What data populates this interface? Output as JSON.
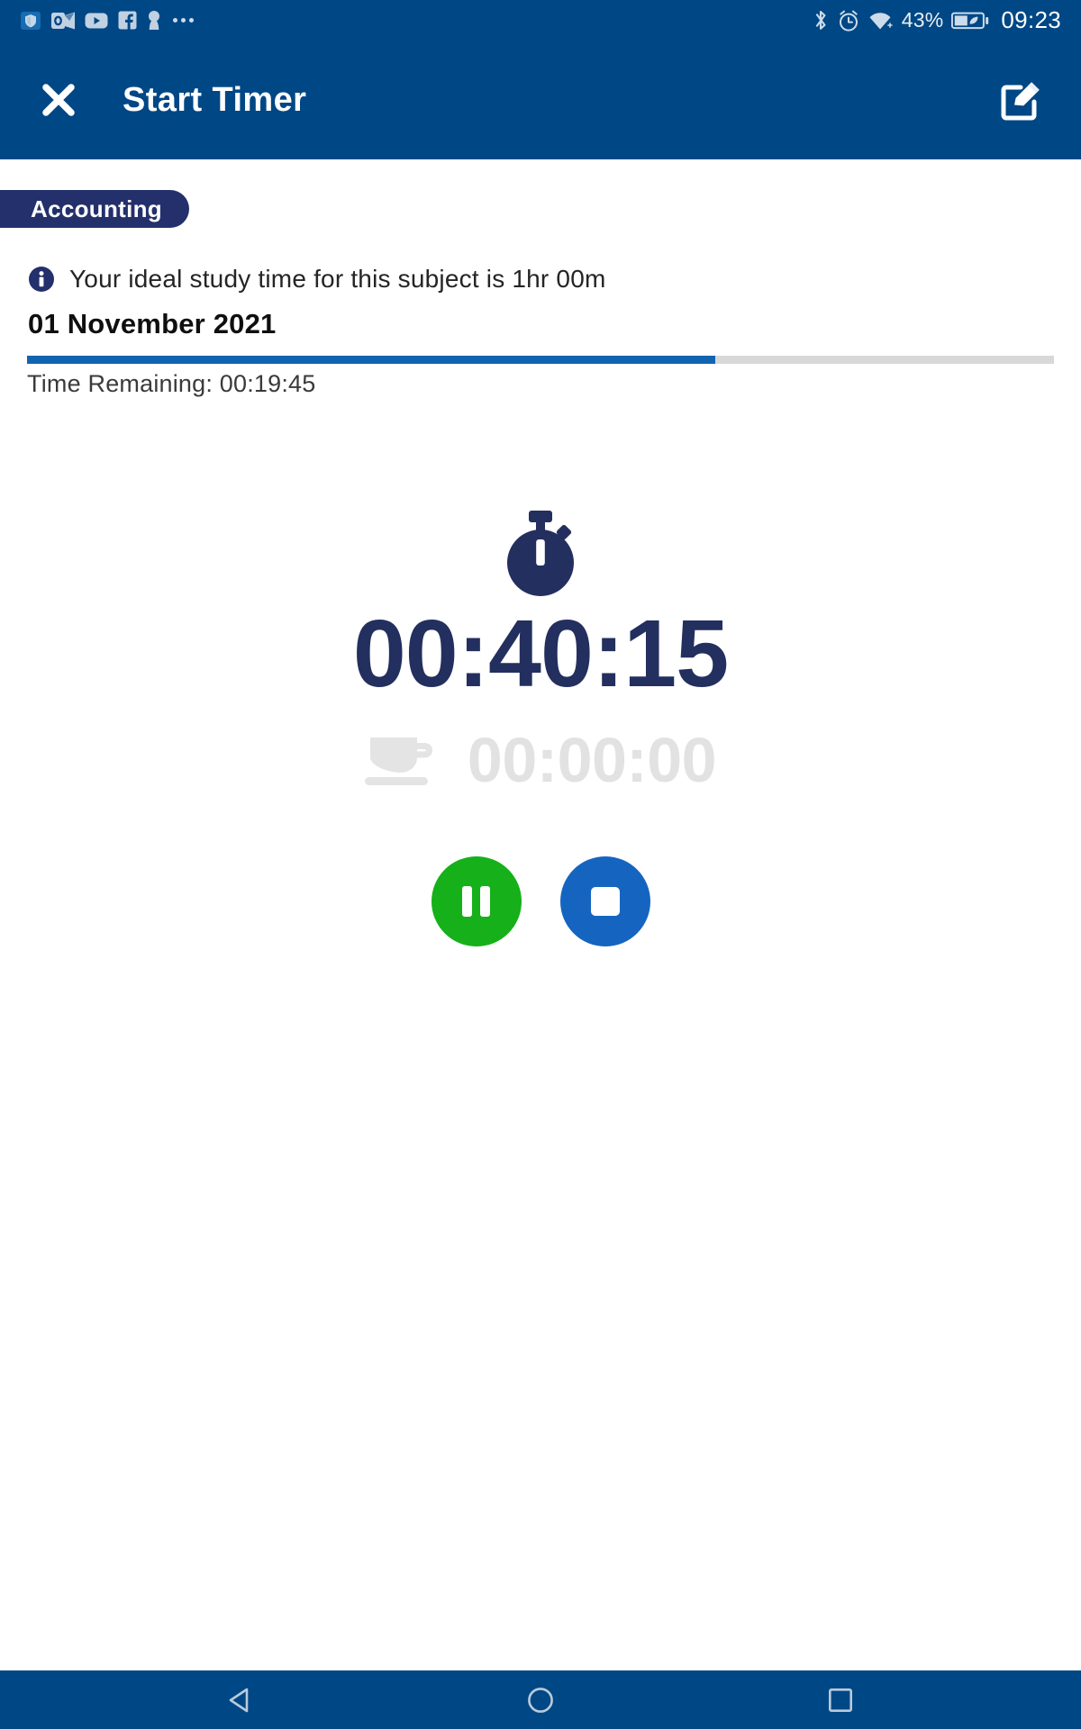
{
  "status_bar": {
    "left_icons": [
      "shield-icon",
      "outlook-icon",
      "youtube-icon",
      "facebook-icon",
      "keyhole-icon",
      "overflow-dots-icon"
    ],
    "right_icons": [
      "bluetooth-icon",
      "alarm-icon",
      "wifi-icon"
    ],
    "battery_percent": "43%",
    "battery_icon": "battery-eco-icon",
    "clock": "09:23",
    "background_color": "#004785"
  },
  "app_bar": {
    "close_label": "close-icon",
    "title": "Start Timer",
    "edit_label": "edit-icon",
    "background_color": "#004785"
  },
  "main": {
    "subject_chip": {
      "label": "Accounting",
      "color": "#23306b"
    },
    "ideal_time_note": {
      "icon": "info-icon",
      "text": "Your ideal study time for this subject is 1hr 00m"
    },
    "date": "01 November 2021",
    "progress": {
      "percent": 67,
      "fill_color": "#1264b0",
      "track_color": "#d8d8d8"
    },
    "time_remaining_label": "Time Remaining: 00:19:45",
    "timer": {
      "icon": "stopwatch-icon",
      "elapsed": "00:40:15",
      "color": "#232f5e"
    },
    "break_timer": {
      "icon": "coffee-cup-icon",
      "elapsed": "00:00:00",
      "color": "#e2e2e2"
    },
    "controls": [
      {
        "name": "pause-button",
        "icon": "pause-icon",
        "color": "#15b01a"
      },
      {
        "name": "stop-button",
        "icon": "stop-icon",
        "color": "#1565c0"
      }
    ]
  },
  "nav_bar": {
    "back": "back-triangle-icon",
    "home": "home-circle-icon",
    "recents": "recents-square-icon",
    "background_color": "#004785"
  }
}
